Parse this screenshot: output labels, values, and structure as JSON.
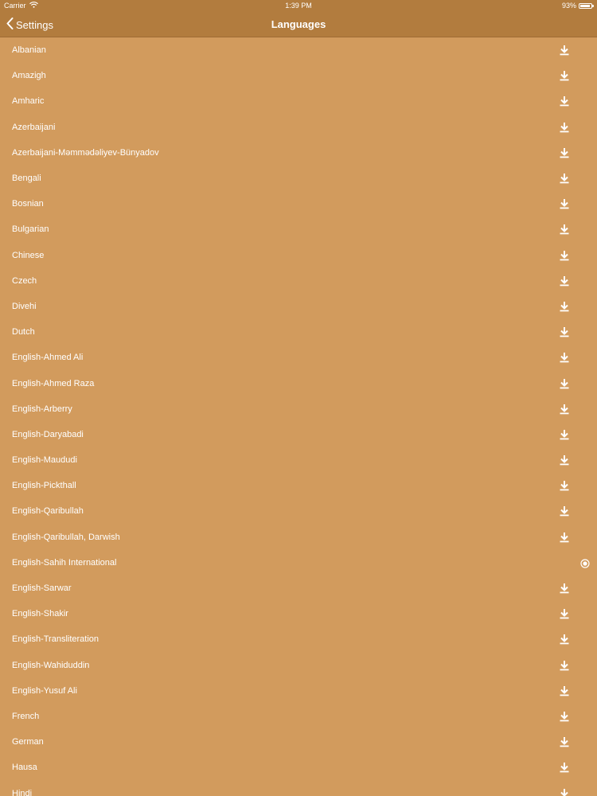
{
  "status_bar": {
    "carrier": "Carrier",
    "time": "1:39 PM",
    "battery": "93%",
    "battery_level": 0.93
  },
  "nav": {
    "back_label": "Settings",
    "title": "Languages"
  },
  "languages": [
    {
      "label": "Albanian",
      "state": "download"
    },
    {
      "label": "Amazigh",
      "state": "download"
    },
    {
      "label": "Amharic",
      "state": "download"
    },
    {
      "label": "Azerbaijani",
      "state": "download"
    },
    {
      "label": "Azerbaijani-Məmmədəliyev-Bünyadov",
      "state": "download"
    },
    {
      "label": "Bengali",
      "state": "download"
    },
    {
      "label": "Bosnian",
      "state": "download"
    },
    {
      "label": "Bulgarian",
      "state": "download"
    },
    {
      "label": "Chinese",
      "state": "download"
    },
    {
      "label": "Czech",
      "state": "download"
    },
    {
      "label": "Divehi",
      "state": "download"
    },
    {
      "label": "Dutch",
      "state": "download"
    },
    {
      "label": "English-Ahmed Ali",
      "state": "download"
    },
    {
      "label": "English-Ahmed Raza",
      "state": "download"
    },
    {
      "label": "English-Arberry",
      "state": "download"
    },
    {
      "label": "English-Daryabadi",
      "state": "download"
    },
    {
      "label": "English-Maududi",
      "state": "download"
    },
    {
      "label": "English-Pickthall",
      "state": "download"
    },
    {
      "label": "English-Qaribullah",
      "state": "download"
    },
    {
      "label": "English-Qaribullah, Darwish",
      "state": "download"
    },
    {
      "label": "English-Sahih International",
      "state": "selected"
    },
    {
      "label": "English-Sarwar",
      "state": "download"
    },
    {
      "label": "English-Shakir",
      "state": "download"
    },
    {
      "label": "English-Transliteration",
      "state": "download"
    },
    {
      "label": "English-Wahiduddin",
      "state": "download"
    },
    {
      "label": "English-Yusuf Ali",
      "state": "download"
    },
    {
      "label": "French",
      "state": "download"
    },
    {
      "label": "German",
      "state": "download"
    },
    {
      "label": "Hausa",
      "state": "download"
    },
    {
      "label": "Hindi",
      "state": "download"
    }
  ],
  "icons": {
    "download": "download-icon",
    "selected": "radio-selected-icon",
    "back": "chevron-left-icon",
    "wifi": "wifi-icon",
    "battery": "battery-icon"
  }
}
